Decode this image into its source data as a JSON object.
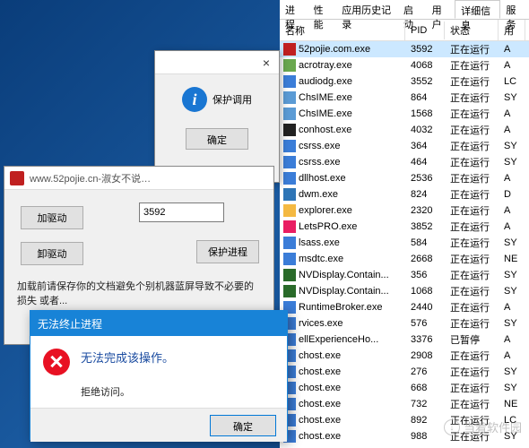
{
  "taskmgr": {
    "tabs": [
      "进程",
      "性能",
      "应用历史记录",
      "启动",
      "用户",
      "详细信息",
      "服务"
    ],
    "active_tab": 5,
    "columns": [
      "名称",
      "PID",
      "状态",
      "用"
    ],
    "rows": [
      {
        "icon": "#c02020",
        "name": "52pojie.com.exe",
        "pid": "3592",
        "status": "正在运行",
        "user": "A",
        "sel": true
      },
      {
        "icon": "#6aa84f",
        "name": "acrotray.exe",
        "pid": "4068",
        "status": "正在运行",
        "user": "A"
      },
      {
        "icon": "#3b7dd8",
        "name": "audiodg.exe",
        "pid": "3552",
        "status": "正在运行",
        "user": "LC"
      },
      {
        "icon": "#5b9bd5",
        "name": "ChsIME.exe",
        "pid": "864",
        "status": "正在运行",
        "user": "SY"
      },
      {
        "icon": "#5b9bd5",
        "name": "ChsIME.exe",
        "pid": "1568",
        "status": "正在运行",
        "user": "A"
      },
      {
        "icon": "#222",
        "name": "conhost.exe",
        "pid": "4032",
        "status": "正在运行",
        "user": "A"
      },
      {
        "icon": "#3b7dd8",
        "name": "csrss.exe",
        "pid": "364",
        "status": "正在运行",
        "user": "SY"
      },
      {
        "icon": "#3b7dd8",
        "name": "csrss.exe",
        "pid": "464",
        "status": "正在运行",
        "user": "SY"
      },
      {
        "icon": "#3b7dd8",
        "name": "dllhost.exe",
        "pid": "2536",
        "status": "正在运行",
        "user": "A"
      },
      {
        "icon": "#2e75b6",
        "name": "dwm.exe",
        "pid": "824",
        "status": "正在运行",
        "user": "D"
      },
      {
        "icon": "#f4b942",
        "name": "explorer.exe",
        "pid": "2320",
        "status": "正在运行",
        "user": "A"
      },
      {
        "icon": "#e91e63",
        "name": "LetsPRO.exe",
        "pid": "3852",
        "status": "正在运行",
        "user": "A"
      },
      {
        "icon": "#3b7dd8",
        "name": "lsass.exe",
        "pid": "584",
        "status": "正在运行",
        "user": "SY"
      },
      {
        "icon": "#3b7dd8",
        "name": "msdtc.exe",
        "pid": "2668",
        "status": "正在运行",
        "user": "NE"
      },
      {
        "icon": "#2a6b2a",
        "name": "NVDisplay.Contain...",
        "pid": "356",
        "status": "正在运行",
        "user": "SY"
      },
      {
        "icon": "#2a6b2a",
        "name": "NVDisplay.Contain...",
        "pid": "1068",
        "status": "正在运行",
        "user": "SY"
      },
      {
        "icon": "#3b7dd8",
        "name": "RuntimeBroker.exe",
        "pid": "2440",
        "status": "正在运行",
        "user": "A"
      },
      {
        "icon": "#3b7dd8",
        "name": "rvices.exe",
        "pid": "576",
        "status": "正在运行",
        "user": "SY"
      },
      {
        "icon": "#3b7dd8",
        "name": "ellExperienceHo...",
        "pid": "3376",
        "status": "已暂停",
        "user": "A"
      },
      {
        "icon": "#3b7dd8",
        "name": "chost.exe",
        "pid": "2908",
        "status": "正在运行",
        "user": "A"
      },
      {
        "icon": "#3b7dd8",
        "name": "chost.exe",
        "pid": "276",
        "status": "正在运行",
        "user": "SY"
      },
      {
        "icon": "#3b7dd8",
        "name": "chost.exe",
        "pid": "668",
        "status": "正在运行",
        "user": "SY"
      },
      {
        "icon": "#3b7dd8",
        "name": "chost.exe",
        "pid": "732",
        "status": "正在运行",
        "user": "NE"
      },
      {
        "icon": "#3b7dd8",
        "name": "chost.exe",
        "pid": "892",
        "status": "正在运行",
        "user": "LC"
      },
      {
        "icon": "#3b7dd8",
        "name": "chost.exe",
        "pid": "988",
        "status": "正在运行",
        "user": "SY"
      }
    ]
  },
  "mainwin": {
    "title": "www.52pojie.cn-淑女不说…",
    "btn_add": "加驱动",
    "btn_remove": "卸驱动",
    "btn_protect": "保护进程",
    "input_value": "3592",
    "message": "加载前请保存你的文档避免个别机器蓝屏导致不必要的损失\n或者..."
  },
  "infodlg": {
    "text": "保护调用",
    "ok": "确定"
  },
  "errdlg": {
    "title": "无法终止进程",
    "main": "无法完成该操作。",
    "sub": "拒绝访问。",
    "ok": "确定"
  },
  "watermark": "当着软件园"
}
